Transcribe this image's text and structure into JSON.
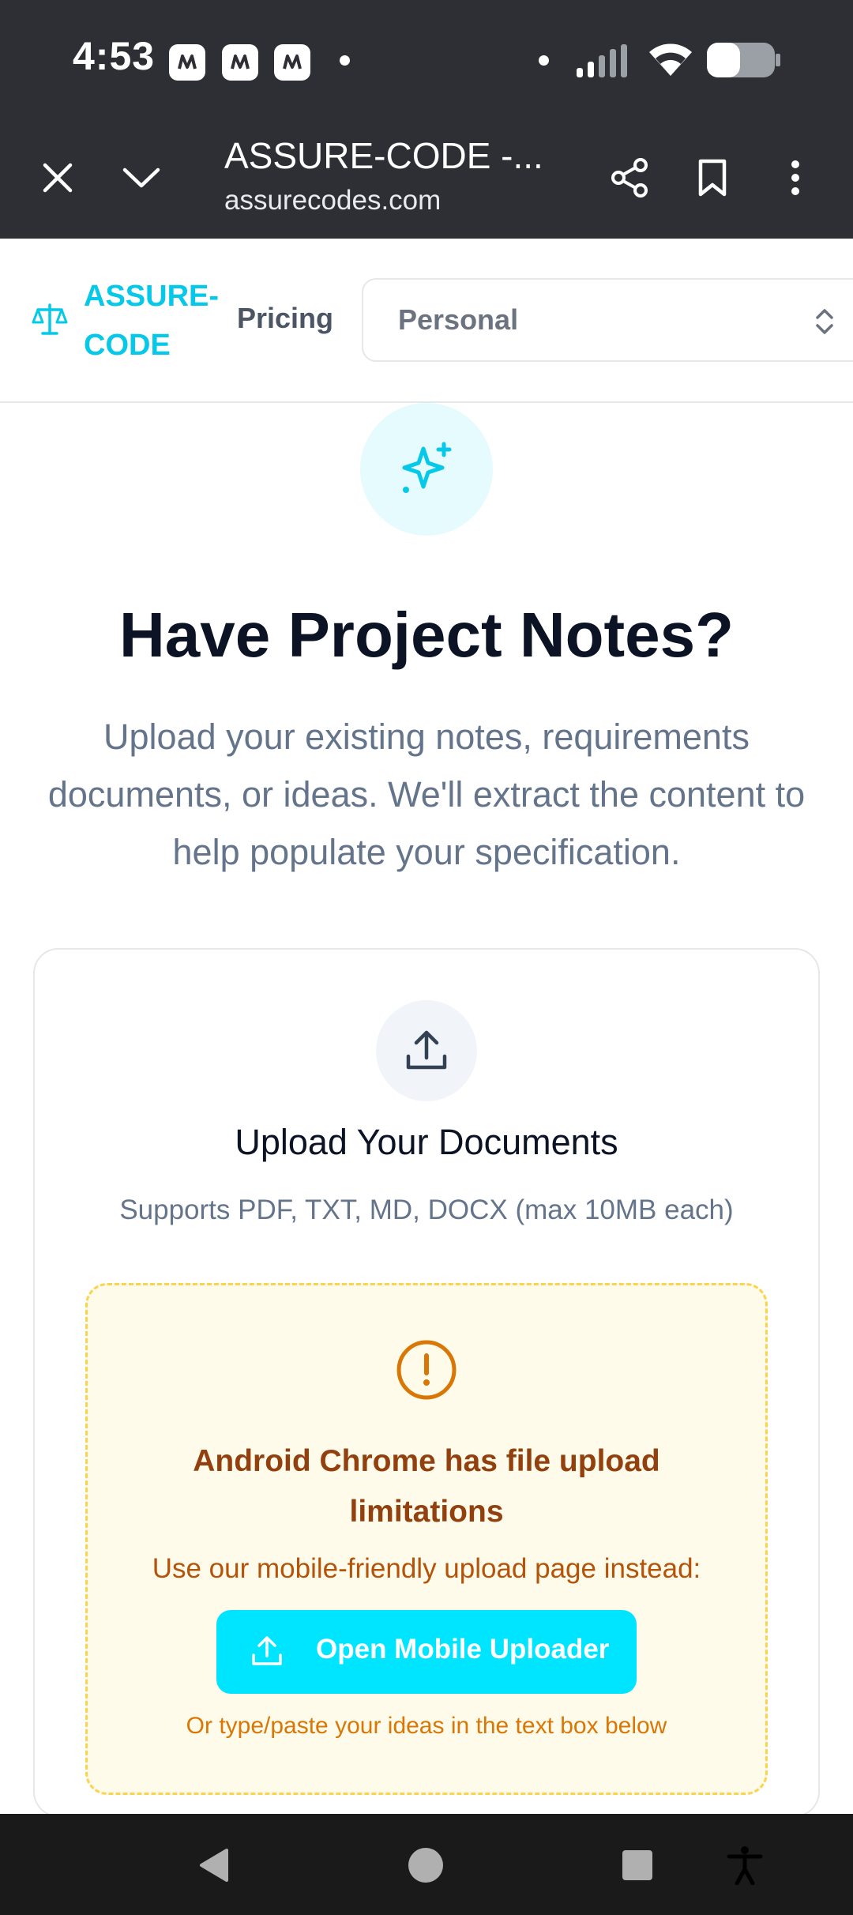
{
  "status_bar": {
    "time": "4:53",
    "notification_icons": [
      "news-app-icon",
      "news-app-icon",
      "news-app-icon"
    ],
    "indicators": [
      "signal-icon",
      "wifi-icon",
      "battery-icon"
    ]
  },
  "browser": {
    "page_title": "ASSURE-CODE -...",
    "domain": "assurecodes.com",
    "actions": [
      "share-icon",
      "bookmark-icon",
      "more-vert-icon"
    ]
  },
  "header": {
    "brand": "ASSURE-CODE",
    "brand_line1": "ASSURE-",
    "brand_line2": "CODE",
    "nav_pricing": "Pricing",
    "plan_select_value": "Personal"
  },
  "hero": {
    "title": "Have Project Notes?",
    "description": "Upload your existing notes, requirements documents, or ideas. We'll extract the content to help populate your specification."
  },
  "upload": {
    "title": "Upload Your Documents",
    "subtitle": "Supports PDF, TXT, MD, DOCX (max 10MB each)"
  },
  "warning": {
    "title": "Android Chrome has file upload limitations",
    "text": "Use our mobile-friendly upload page instead:",
    "button_label": "Open Mobile Uploader",
    "footnote": "Or type/paste your ideas in the text box below"
  },
  "colors": {
    "accent": "#06c8e8",
    "button": "#00e5ff",
    "warning_text": "#92400e",
    "warning_border": "#fcd34d"
  }
}
